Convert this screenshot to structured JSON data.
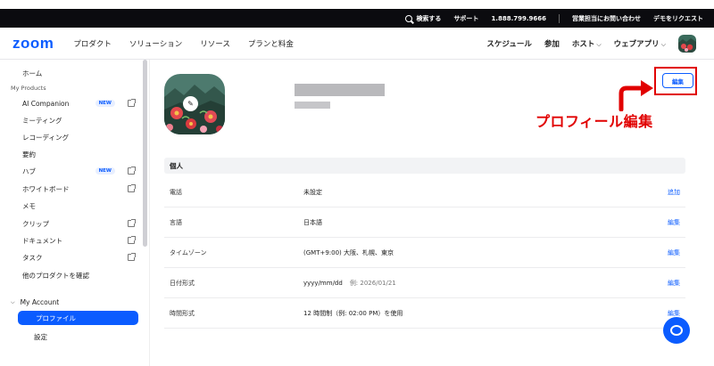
{
  "topbar": {
    "search": "検索する",
    "support": "サポート",
    "phone": "1.888.799.9666",
    "contact_sales": "営業担当にお問い合わせ",
    "request_demo": "デモをリクエスト"
  },
  "nav": {
    "logo": "zoom",
    "left_items": [
      "プロダクト",
      "ソリューション",
      "リソース",
      "プランと料金"
    ],
    "schedule": "スケジュール",
    "join": "参加",
    "host": "ホスト",
    "webapp": "ウェブアプリ"
  },
  "sidebar": {
    "home": "ホーム",
    "category": "My Products",
    "items": [
      {
        "label": "AI Companion",
        "badge": "NEW",
        "external": true
      },
      {
        "label": "ミーティング",
        "badge": "",
        "external": false
      },
      {
        "label": "レコーディング",
        "badge": "",
        "external": false
      },
      {
        "label": "要約",
        "badge": "",
        "external": false
      },
      {
        "label": "ハブ",
        "badge": "NEW",
        "external": true
      },
      {
        "label": "ホワイトボード",
        "badge": "",
        "external": true
      },
      {
        "label": "メモ",
        "badge": "",
        "external": false
      },
      {
        "label": "クリップ",
        "badge": "",
        "external": true
      },
      {
        "label": "ドキュメント",
        "badge": "",
        "external": true
      },
      {
        "label": "タスク",
        "badge": "",
        "external": true
      },
      {
        "label": "他のプロダクトを確認",
        "badge": "",
        "external": false
      }
    ],
    "account_header": "My Account",
    "active_item": "プロファイル",
    "settings": "設定"
  },
  "profile": {
    "edit_label": "編集",
    "annotation": "プロフィール編集",
    "section_title": "個人",
    "rows": [
      {
        "label": "電話",
        "value": "未設定",
        "hint": "",
        "action": "追加"
      },
      {
        "label": "言語",
        "value": "日本語",
        "hint": "",
        "action": "編集"
      },
      {
        "label": "タイムゾーン",
        "value": "(GMT+9:00) 大阪、札幌、東京",
        "hint": "",
        "action": "編集"
      },
      {
        "label": "日付形式",
        "value": "yyyy/mm/dd",
        "hint": "例: 2026/01/21",
        "action": "編集"
      },
      {
        "label": "時間形式",
        "value": "12 時間制（例: 02:00 PM）を使用",
        "hint": "",
        "action": "編集"
      }
    ]
  },
  "colors": {
    "accent": "#0b5cff",
    "annotation": "#e10000"
  },
  "icons": {
    "search": "search-icon",
    "edit": "pencil-icon",
    "chat": "chat-icon",
    "external": "external-link-icon"
  }
}
